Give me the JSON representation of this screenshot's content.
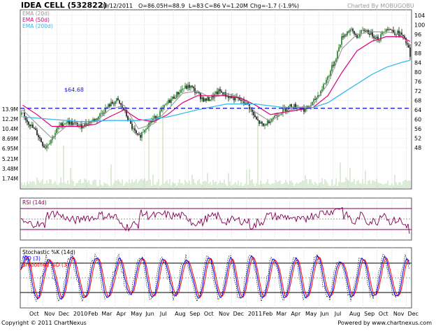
{
  "header": {
    "symbol": "IDEA CELL (532822)",
    "date": "09/12/2011",
    "open": "O=86.05",
    "high": "H=88.9",
    "low": "L=83",
    "close": "C=86",
    "volume": "V=1.20M",
    "change": "Chg=-1.7 (-1.9%)",
    "credit": "Charted By MOBUGOBU"
  },
  "colors": {
    "price": "#006400",
    "ema20": "#999999",
    "ema50": "#e0007a",
    "ema200": "#33bbee",
    "hline": "#2222cc",
    "rsi": "#800055",
    "stoch_k": "#000000",
    "stoch_d": "#0000ff",
    "stoch_sd": "#ff0000",
    "volume": "#b8d8b0"
  },
  "footer": {
    "copyright": "Copyright © 2011 ChartNexus",
    "powered": "Powered by www.chartnexus.com"
  },
  "chart_data": [
    {
      "type": "candlestick",
      "panel": "price",
      "legend": [
        "EMA (20d)",
        "EMA (50d)",
        "EMA (200d)"
      ],
      "hline_label": "$64.68",
      "hline_value": 64.68,
      "y_ticks_right": [
        "104",
        "100",
        "96",
        "92",
        "88",
        "84",
        "80",
        "76",
        "72",
        "68",
        "64",
        "60",
        "56",
        "52",
        "48"
      ],
      "volume_ticks_left": [
        "13.9M",
        "12.2M",
        "10.4M",
        "8.69M",
        "6.95M",
        "5.21M",
        "3.48M",
        "1.74M"
      ],
      "x_labels": [
        "Oct",
        "Nov",
        "Dec",
        "2010",
        "Feb",
        "Mar",
        "Apr",
        "May",
        "Jun",
        "Jul",
        "Aug",
        "Sep",
        "Oct",
        "Nov",
        "Dec",
        "2011",
        "Feb",
        "Mar",
        "Apr",
        "May",
        "Jun",
        "Jul",
        "Aug",
        "Sep",
        "Oct",
        "Nov",
        "Dec"
      ],
      "close_trend": [
        [
          "2009-09-20",
          62
        ],
        [
          "2009-10-05",
          58
        ],
        [
          "2009-10-20",
          54
        ],
        [
          "2009-11-05",
          48
        ],
        [
          "2009-11-20",
          52
        ],
        [
          "2009-12-05",
          57
        ],
        [
          "2009-12-20",
          59
        ],
        [
          "2010-01-05",
          58
        ],
        [
          "2010-01-20",
          57
        ],
        [
          "2010-02-05",
          59
        ],
        [
          "2010-02-20",
          60
        ],
        [
          "2010-03-05",
          63
        ],
        [
          "2010-03-20",
          66
        ],
        [
          "2010-04-05",
          68
        ],
        [
          "2010-04-20",
          64
        ],
        [
          "2010-05-05",
          57
        ],
        [
          "2010-05-20",
          52
        ],
        [
          "2010-06-05",
          57
        ],
        [
          "2010-06-20",
          60
        ],
        [
          "2010-07-05",
          63
        ],
        [
          "2010-07-20",
          67
        ],
        [
          "2010-08-05",
          70
        ],
        [
          "2010-08-20",
          73
        ],
        [
          "2010-09-05",
          74
        ],
        [
          "2010-09-20",
          71
        ],
        [
          "2010-10-05",
          68
        ],
        [
          "2010-10-20",
          69
        ],
        [
          "2010-11-05",
          72
        ],
        [
          "2010-11-20",
          70
        ],
        [
          "2010-12-05",
          69
        ],
        [
          "2010-12-20",
          68
        ],
        [
          "2011-01-05",
          66
        ],
        [
          "2011-01-20",
          60
        ],
        [
          "2011-02-05",
          57
        ],
        [
          "2011-02-20",
          60
        ],
        [
          "2011-03-05",
          62
        ],
        [
          "2011-03-20",
          64
        ],
        [
          "2011-04-05",
          66
        ],
        [
          "2011-04-20",
          65
        ],
        [
          "2011-05-05",
          64
        ],
        [
          "2011-05-20",
          67
        ],
        [
          "2011-06-05",
          72
        ],
        [
          "2011-06-20",
          78
        ],
        [
          "2011-07-05",
          85
        ],
        [
          "2011-07-20",
          95
        ],
        [
          "2011-08-05",
          98
        ],
        [
          "2011-08-20",
          95
        ],
        [
          "2011-09-05",
          98
        ],
        [
          "2011-09-20",
          96
        ],
        [
          "2011-10-05",
          94
        ],
        [
          "2011-10-20",
          99
        ],
        [
          "2011-11-05",
          97
        ],
        [
          "2011-11-20",
          96
        ],
        [
          "2011-12-05",
          91
        ],
        [
          "2011-12-09",
          86
        ]
      ],
      "ema20": [
        [
          "2009-09-20",
          64
        ],
        [
          "2009-10-20",
          58
        ],
        [
          "2009-11-20",
          52
        ],
        [
          "2009-12-20",
          57
        ],
        [
          "2010-01-20",
          58
        ],
        [
          "2010-02-20",
          59
        ],
        [
          "2010-03-20",
          64
        ],
        [
          "2010-04-20",
          66
        ],
        [
          "2010-05-20",
          56
        ],
        [
          "2010-06-20",
          58
        ],
        [
          "2010-07-20",
          64
        ],
        [
          "2010-08-20",
          71
        ],
        [
          "2010-09-20",
          72
        ],
        [
          "2010-10-20",
          69
        ],
        [
          "2010-11-20",
          71
        ],
        [
          "2010-12-20",
          69
        ],
        [
          "2011-01-20",
          63
        ],
        [
          "2011-02-20",
          59
        ],
        [
          "2011-03-20",
          63
        ],
        [
          "2011-04-20",
          65
        ],
        [
          "2011-05-20",
          66
        ],
        [
          "2011-06-20",
          75
        ],
        [
          "2011-07-20",
          90
        ],
        [
          "2011-08-20",
          96
        ],
        [
          "2011-09-20",
          97
        ],
        [
          "2011-10-20",
          97
        ],
        [
          "2011-11-20",
          96
        ],
        [
          "2011-12-09",
          91
        ]
      ],
      "ema50": [
        [
          "2009-09-20",
          66
        ],
        [
          "2009-10-20",
          62
        ],
        [
          "2009-11-20",
          57
        ],
        [
          "2009-12-20",
          57
        ],
        [
          "2010-01-20",
          57
        ],
        [
          "2010-02-20",
          58
        ],
        [
          "2010-03-20",
          61
        ],
        [
          "2010-04-20",
          64
        ],
        [
          "2010-05-20",
          60
        ],
        [
          "2010-06-20",
          59
        ],
        [
          "2010-07-20",
          62
        ],
        [
          "2010-08-20",
          67
        ],
        [
          "2010-09-20",
          70
        ],
        [
          "2010-10-20",
          70
        ],
        [
          "2010-11-20",
          70
        ],
        [
          "2010-12-20",
          69
        ],
        [
          "2011-01-20",
          66
        ],
        [
          "2011-02-20",
          62
        ],
        [
          "2011-03-20",
          63
        ],
        [
          "2011-04-20",
          64
        ],
        [
          "2011-05-20",
          65
        ],
        [
          "2011-06-20",
          70
        ],
        [
          "2011-07-20",
          80
        ],
        [
          "2011-08-20",
          89
        ],
        [
          "2011-09-20",
          93
        ],
        [
          "2011-10-20",
          95
        ],
        [
          "2011-11-20",
          95
        ],
        [
          "2011-12-09",
          93
        ]
      ],
      "ema200": [
        [
          "2009-09-20",
          61
        ],
        [
          "2009-11-20",
          60
        ],
        [
          "2010-01-20",
          59
        ],
        [
          "2010-03-20",
          59.5
        ],
        [
          "2010-05-20",
          59.5
        ],
        [
          "2010-07-20",
          61
        ],
        [
          "2010-09-20",
          64
        ],
        [
          "2010-11-20",
          66.5
        ],
        [
          "2011-01-20",
          66.5
        ],
        [
          "2011-03-20",
          65
        ],
        [
          "2011-05-20",
          65
        ],
        [
          "2011-06-20",
          67
        ],
        [
          "2011-07-20",
          71
        ],
        [
          "2011-08-20",
          75
        ],
        [
          "2011-09-20",
          79
        ],
        [
          "2011-10-20",
          82
        ],
        [
          "2011-11-20",
          84
        ],
        [
          "2011-12-09",
          85
        ]
      ],
      "volume_spikes": [
        [
          "2009-10-10",
          5.0
        ],
        [
          "2009-12-15",
          7.5
        ],
        [
          "2010-03-25",
          4.2
        ],
        [
          "2010-06-10",
          12.0
        ],
        [
          "2010-07-10",
          14.0
        ],
        [
          "2011-01-25",
          13.5
        ],
        [
          "2011-02-01",
          8.0
        ],
        [
          "2011-07-15",
          4.5
        ],
        [
          "2011-08-05",
          3.6
        ]
      ]
    },
    {
      "type": "line",
      "panel": "rsi",
      "legend": [
        "RSI (14d)"
      ],
      "levels": [
        70,
        50,
        30
      ],
      "x_labels": [
        "Oct",
        "Nov",
        "Dec",
        "2010",
        "Feb",
        "Mar",
        "Apr",
        "May",
        "Jun",
        "Jul",
        "Aug",
        "Sep",
        "Oct",
        "Nov",
        "Dec",
        "2011",
        "Feb",
        "Mar",
        "Apr",
        "May",
        "Jun",
        "Jul",
        "Aug",
        "Sep",
        "Oct",
        "Nov",
        "Dec"
      ]
    },
    {
      "type": "line",
      "panel": "stochastic",
      "legend": [
        "Stochastic %K (14d)",
        "%D (3)",
        "Smoothed %D (3)"
      ],
      "levels": [
        80,
        50,
        20
      ],
      "x_labels": [
        "Oct",
        "Nov",
        "Dec",
        "2010",
        "Feb",
        "Mar",
        "Apr",
        "May",
        "Jun",
        "Jul",
        "Aug",
        "Sep",
        "Oct",
        "Nov",
        "Dec",
        "2011",
        "Feb",
        "Mar",
        "Apr",
        "May",
        "Jun",
        "Jul",
        "Aug",
        "Sep",
        "Oct",
        "Nov",
        "Dec"
      ]
    }
  ]
}
